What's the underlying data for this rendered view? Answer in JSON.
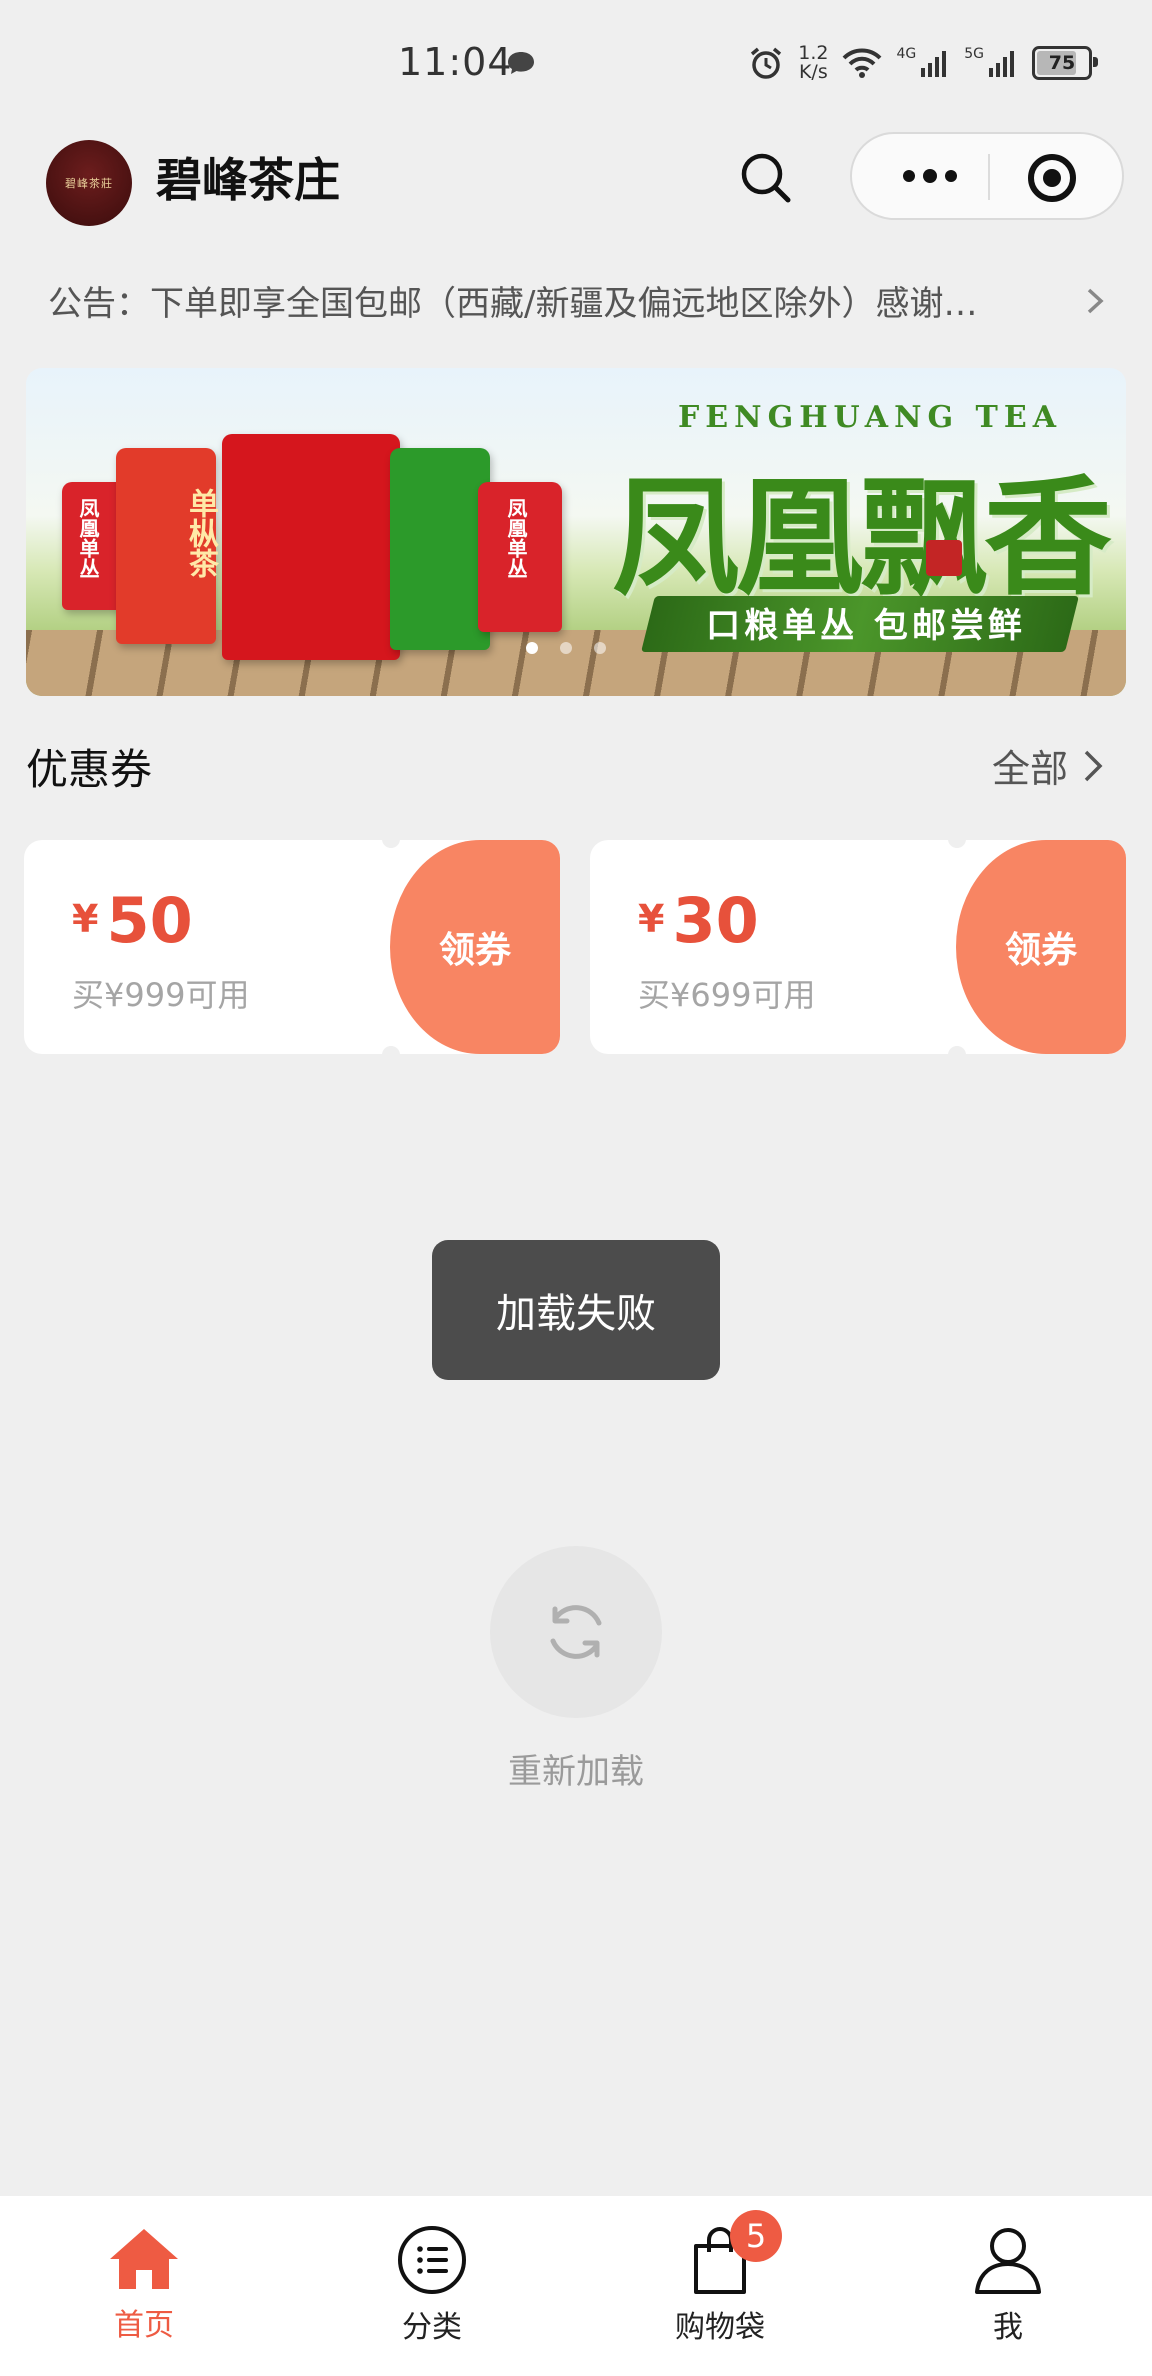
{
  "status_bar": {
    "time": "11:04",
    "speed_value": "1.2",
    "speed_unit": "K/s",
    "net1": "4G",
    "net2": "5G",
    "battery": "75"
  },
  "header": {
    "shop_name": "碧峰茶庄",
    "logo_text": "碧峰茶莊"
  },
  "notice": {
    "label": "公告：",
    "text": "下单即享全国包邮（西藏/新疆及偏远地区除外）感谢…"
  },
  "banner": {
    "brand_en": "FENGHUANG TEA",
    "title": "凤凰飘香",
    "subtitle": "口粮单丛  包邮尝鲜",
    "bag_labels": [
      "凤凰单丛",
      "单枞茶",
      "凤凰单丛"
    ]
  },
  "coupons": {
    "title": "优惠券",
    "all_label": "全部",
    "items": [
      {
        "symbol": "¥",
        "amount": "50",
        "condition": "买¥999可用",
        "claim": "领券"
      },
      {
        "symbol": "¥",
        "amount": "30",
        "condition": "买¥699可用",
        "claim": "领券"
      }
    ]
  },
  "toast": {
    "text": "加载失败"
  },
  "reload": {
    "label": "重新加载"
  },
  "tabbar": {
    "tabs": [
      {
        "label": "首页",
        "icon": "home-icon"
      },
      {
        "label": "分类",
        "icon": "list-icon"
      },
      {
        "label": "购物袋",
        "icon": "bag-icon",
        "badge": "5"
      },
      {
        "label": "我",
        "icon": "user-icon"
      }
    ],
    "active_color": "#ee5b43"
  },
  "colors": {
    "accent": "#ee5b43",
    "coupon_amount": "#e7513b",
    "coupon_claim_bg": "#f88563",
    "page_bg": "#efefef"
  }
}
